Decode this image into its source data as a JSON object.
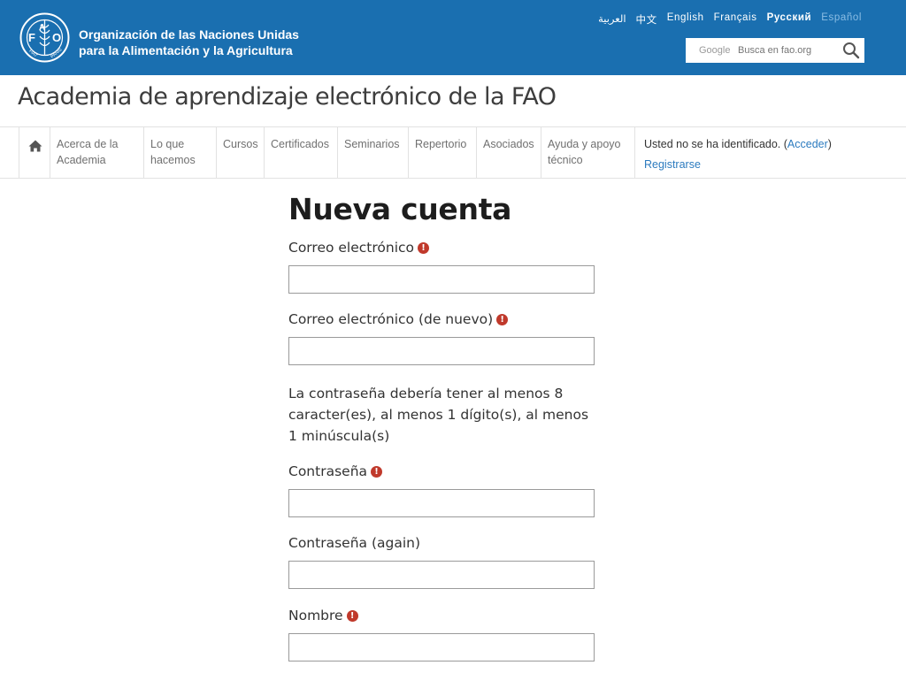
{
  "header": {
    "org_line1": "Organización de las Naciones Unidas",
    "org_line2": "para la Alimentación y la Agricultura",
    "logo_text": {
      "center": "FAO",
      "left": "FIAT",
      "right": "PANIS"
    },
    "languages": [
      {
        "label": "العربية"
      },
      {
        "label": "中文"
      },
      {
        "label": "English"
      },
      {
        "label": "Français"
      },
      {
        "label": "Русский"
      },
      {
        "label": "Español"
      }
    ],
    "search": {
      "provider": "Google",
      "placeholder": "Busca en fao.org",
      "icon": "search-icon"
    }
  },
  "site_title": "Academia de aprendizaje electrónico de la FAO",
  "nav": {
    "home_icon": "home-icon",
    "items": [
      {
        "line1": "Acerca de la",
        "line2": "Academia"
      },
      {
        "line1": "Lo que",
        "line2": "hacemos"
      },
      {
        "line1": "Cursos",
        "line2": ""
      },
      {
        "line1": "Certificados",
        "line2": ""
      },
      {
        "line1": "Seminarios",
        "line2": ""
      },
      {
        "line1": "Repertorio",
        "line2": ""
      },
      {
        "line1": "Asociados",
        "line2": ""
      },
      {
        "line1": "Ayuda y apoyo",
        "line2": "técnico"
      }
    ],
    "login_status": "Usted no se ha identificado. (",
    "login_link": "Acceder",
    "login_close": ")",
    "register_link": "Registrarse"
  },
  "form": {
    "title": "Nueva cuenta",
    "email_label": "Correo electrónico",
    "email2_label": "Correo electrónico (de nuevo)",
    "password_policy": "La contraseña debería tener al menos 8 caracter(es), al menos 1 dígito(s), al menos 1 minúscula(s)",
    "password_label": "Contraseña",
    "password2_label": "Contraseña (again)",
    "name_label": "Nombre",
    "required_icon": "!",
    "email_value": "",
    "email2_value": "",
    "password_value": "",
    "password2_value": "",
    "name_value": ""
  },
  "colors": {
    "banner": "#1a6fb0",
    "link": "#2c7bbf",
    "required": "#c0392b",
    "current_language": "#8bbde4"
  }
}
